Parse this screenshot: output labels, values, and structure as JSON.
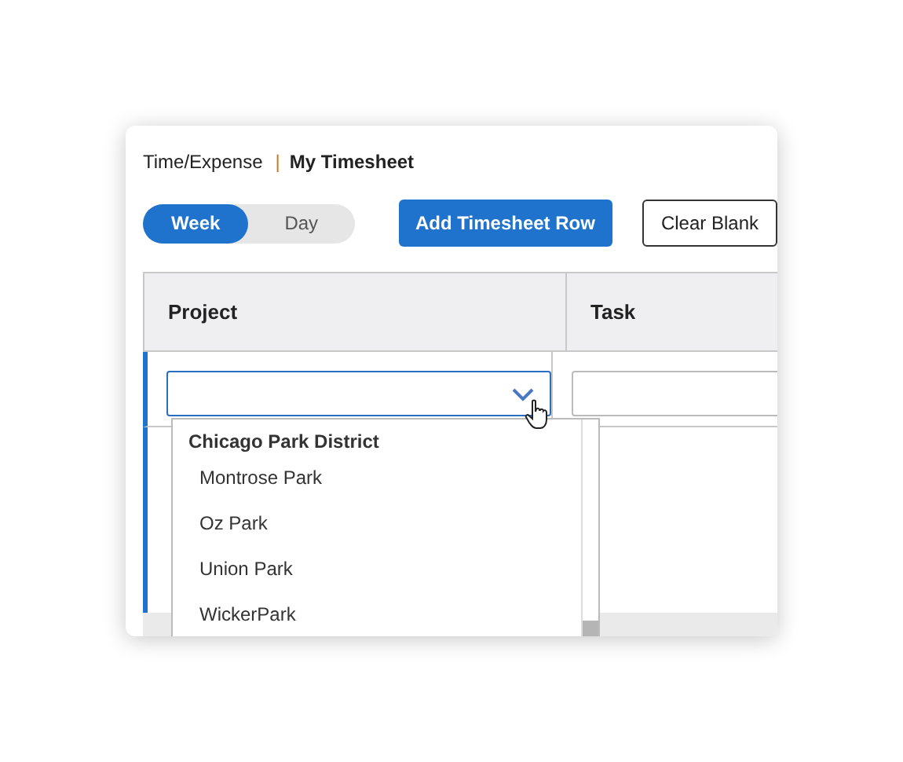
{
  "breadcrumb": {
    "parent": "Time/Expense",
    "separator": "|",
    "current": "My Timesheet"
  },
  "view_toggle": [
    {
      "label": "Week",
      "selected": true
    },
    {
      "label": "Day",
      "selected": false
    }
  ],
  "buttons": [
    {
      "label": "Add Timesheet Row",
      "kind": "primary"
    },
    {
      "label": "Clear Blank",
      "kind": "secondary"
    }
  ],
  "table": {
    "columns": [
      "Project",
      "Task"
    ]
  },
  "project_dropdown": {
    "expanded": true,
    "group": "Chicago Park District",
    "options": [
      "Montrose Park",
      "Oz Park",
      "Union Park",
      "WickerPark"
    ]
  }
}
